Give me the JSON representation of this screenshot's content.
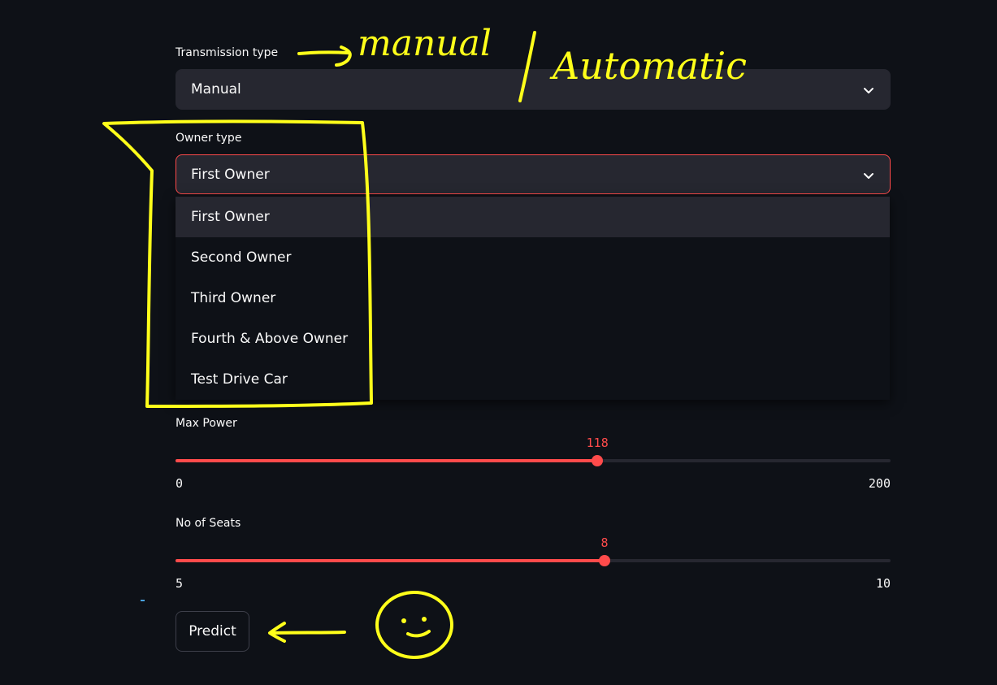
{
  "transmission": {
    "label": "Transmission type",
    "value": "Manual"
  },
  "owner": {
    "label": "Owner type",
    "value": "First Owner",
    "options": [
      "First Owner",
      "Second Owner",
      "Third Owner",
      "Fourth & Above Owner",
      "Test Drive Car"
    ],
    "highlighted": 0
  },
  "max_power": {
    "label": "Max Power",
    "value": "118",
    "min": "0",
    "max": "200",
    "fraction": 0.59
  },
  "seats": {
    "label": "No of Seats",
    "value": "8",
    "min": "5",
    "max": "10",
    "fraction": 0.6
  },
  "predict_button": {
    "label": "Predict"
  },
  "annotations": {
    "transmission_note": "manual",
    "transmission_note_2": "Automatic",
    "color": "#ffff1a"
  },
  "colors": {
    "background": "#0e1117",
    "widget": "#262730",
    "accent": "#ff4b4b"
  },
  "icons": {
    "select_chevron": "chevron-down-icon"
  }
}
